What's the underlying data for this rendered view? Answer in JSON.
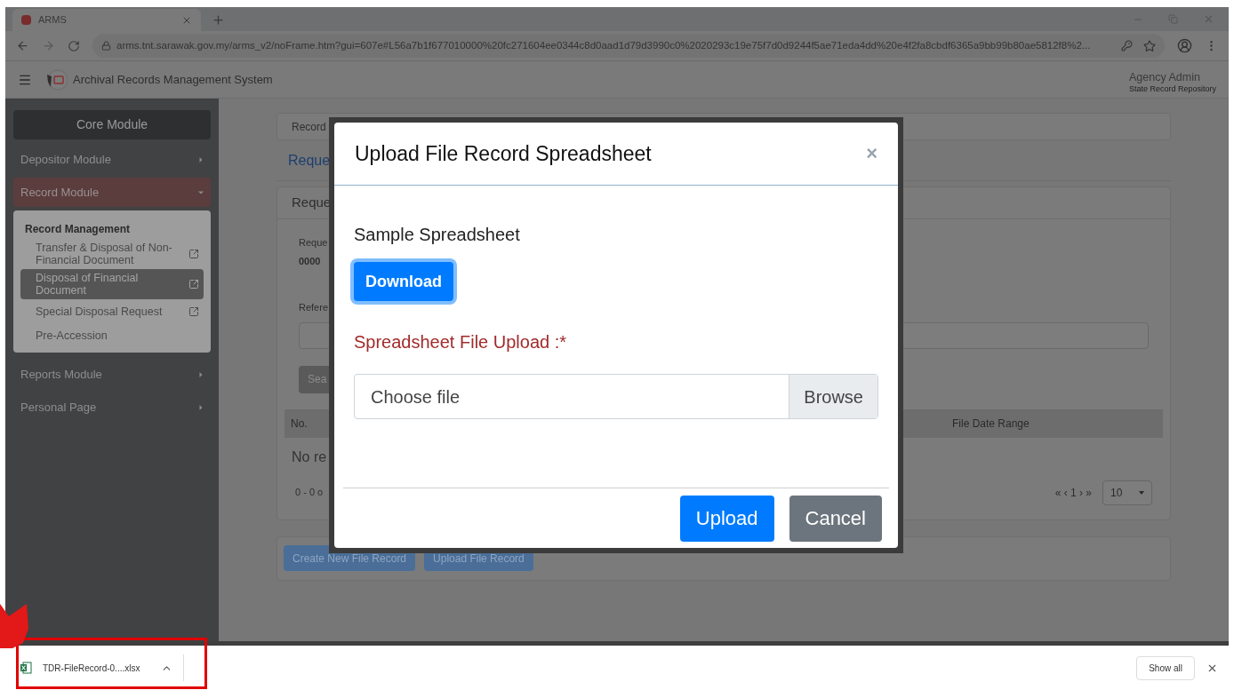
{
  "browser": {
    "tab": {
      "title": "ARMS"
    },
    "url": "arms.tnt.sarawak.gov.my/arms_v2/noFrame.htm?gui=607e#L56a7b1f677010000%20fc271604ee0344c8d0aad1d79d3990c0%2020293c19e75f7d0d9244f5ae71eda4dd%20e4f2fa8cbdf6365a9bb99b80ae5812f8%2..."
  },
  "header": {
    "title": "Archival Records Management System",
    "user": "Agency Admin",
    "role": "State Record Repository"
  },
  "sidebar": {
    "title": "Core Module",
    "items": [
      {
        "label": "Depositor Module",
        "expanded": false,
        "selected": false
      },
      {
        "label": "Record Module",
        "expanded": true,
        "selected": true,
        "group": {
          "heading": "Record Management",
          "children": [
            {
              "label": "Transfer & Disposal of Non-Financial Document",
              "external": true,
              "selected": false
            },
            {
              "label": "Disposal of Financial Document",
              "external": true,
              "selected": true
            },
            {
              "label": "Special Disposal Request",
              "external": true,
              "selected": false
            },
            {
              "label": "Pre-Accession",
              "external": false,
              "selected": false
            }
          ]
        }
      },
      {
        "label": "Reports Module",
        "expanded": false,
        "selected": false
      },
      {
        "label": "Personal Page",
        "expanded": false,
        "selected": false
      }
    ]
  },
  "background": {
    "breadcrumb": "Record",
    "link": "Reque",
    "card_title": "Reque",
    "field_label": "Reque",
    "field_value": "0000",
    "input_label": "Refere",
    "search_button": "Sea",
    "table": {
      "columns": [
        "No.",
        "File Date Range"
      ],
      "empty": "No re"
    },
    "count": "0 - 0 o",
    "pager": "« ‹ 1 › »",
    "page_size": "10",
    "buttons": [
      "Create New File Record",
      "Upload File Record"
    ]
  },
  "modal": {
    "title": "Upload File Record Spreadsheet",
    "close": "×",
    "section": "Sample Spreadsheet",
    "download": "Download",
    "upload_label": "Spreadsheet File Upload :*",
    "file": {
      "placeholder": "Choose file",
      "browse": "Browse"
    },
    "buttons": [
      {
        "label": "Upload",
        "kind": "primary"
      },
      {
        "label": "Cancel",
        "kind": "secondary"
      }
    ]
  },
  "downloads": {
    "items": [
      {
        "name": "TDR-FileRecord-0....xlsx"
      }
    ],
    "show_all": "Show all"
  }
}
